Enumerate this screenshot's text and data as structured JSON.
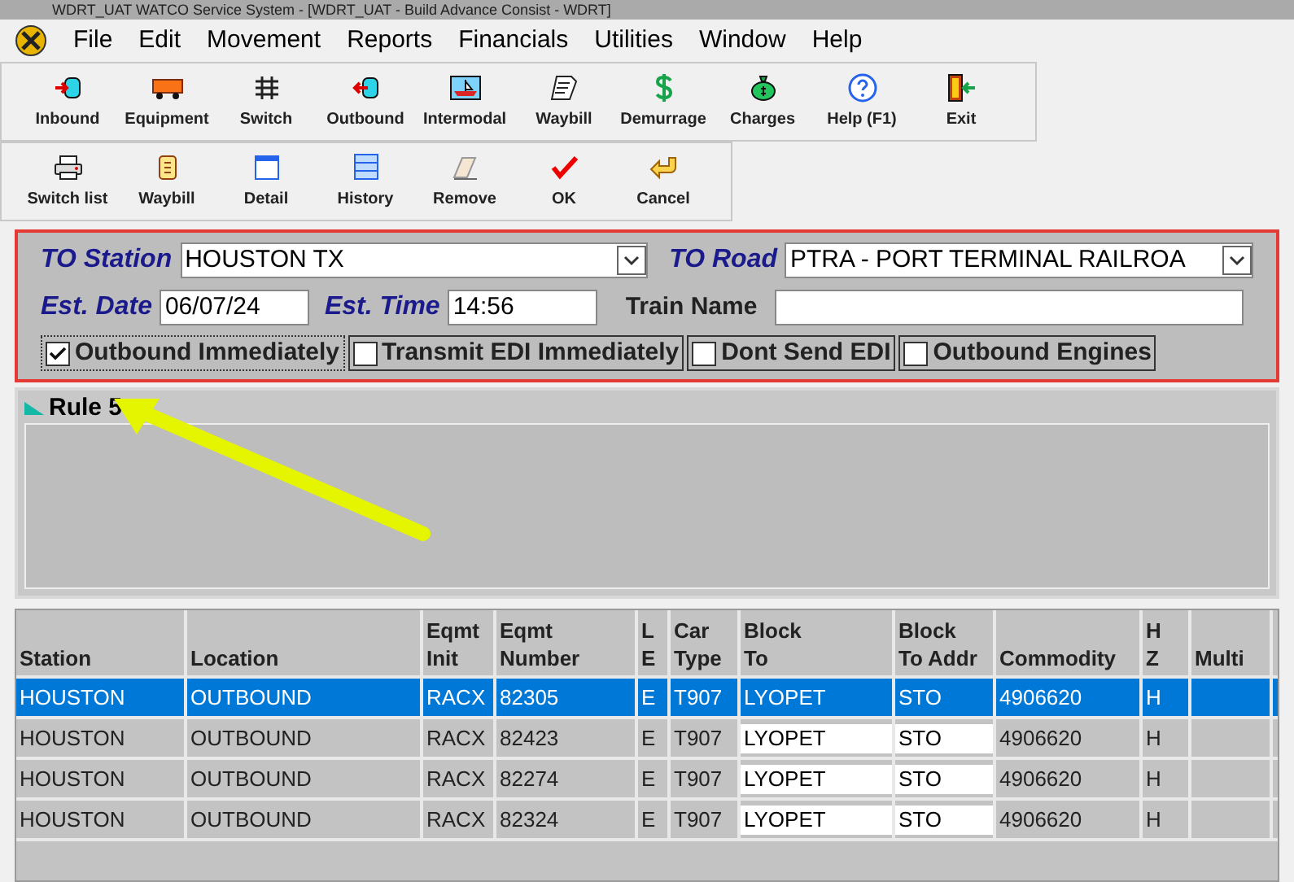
{
  "window": {
    "title": "WDRT_UAT WATCO Service System - [WDRT_UAT - Build Advance Consist - WDRT]"
  },
  "menu": [
    "File",
    "Edit",
    "Movement",
    "Reports",
    "Financials",
    "Utilities",
    "Window",
    "Help"
  ],
  "toolbar_rows": [
    [
      {
        "label": "Inbound"
      },
      {
        "label": "Equipment"
      },
      {
        "label": "Switch"
      },
      {
        "label": "Outbound"
      },
      {
        "label": "Intermodal"
      },
      {
        "label": "Waybill"
      },
      {
        "label": "Demurrage"
      },
      {
        "label": "Charges"
      },
      {
        "label": "Help (F1)"
      },
      {
        "label": "Exit"
      }
    ],
    [
      {
        "label": "Switch list"
      },
      {
        "label": "Waybill"
      },
      {
        "label": "Detail"
      },
      {
        "label": "History"
      },
      {
        "label": "Remove"
      },
      {
        "label": "OK"
      },
      {
        "label": "Cancel"
      }
    ]
  ],
  "form": {
    "to_station": {
      "label": "TO Station",
      "value": "HOUSTON TX"
    },
    "to_road": {
      "label": "TO Road",
      "value": "PTRA - PORT TERMINAL RAILROA"
    },
    "est_date": {
      "label": "Est. Date",
      "value": "06/07/24"
    },
    "est_time": {
      "label": "Est. Time",
      "value": "14:56"
    },
    "train_name": {
      "label": "Train Name"
    },
    "checkboxes": [
      {
        "label": "Outbound Immediately",
        "checked": true
      },
      {
        "label": "Transmit EDI Immediately",
        "checked": false
      },
      {
        "label": "Dont Send EDI",
        "checked": false
      },
      {
        "label": "Outbound Engines",
        "checked": false
      }
    ]
  },
  "rule_section": {
    "label": "Rule 5"
  },
  "table": {
    "columns": [
      {
        "label": "Station",
        "kind": "text"
      },
      {
        "label": "Location",
        "kind": "text"
      },
      {
        "label": "Eqmt\nInit",
        "kind": "text"
      },
      {
        "label": "Eqmt\nNumber",
        "kind": "text"
      },
      {
        "label": "L\nE",
        "kind": "text"
      },
      {
        "label": "Car\nType",
        "kind": "text"
      },
      {
        "label": "Block\nTo",
        "kind": "field"
      },
      {
        "label": "Block\nTo Addr",
        "kind": "field"
      },
      {
        "label": "Commodity",
        "kind": "text"
      },
      {
        "label": "H\nZ",
        "kind": "text"
      },
      {
        "label": "Multi",
        "kind": "text"
      }
    ],
    "rows": [
      {
        "selected": true,
        "cells": [
          "HOUSTON",
          "OUTBOUND",
          "RACX",
          "82305",
          "E",
          "T907",
          "LYOPET",
          "STO",
          "4906620",
          "H",
          ""
        ]
      },
      {
        "selected": false,
        "cells": [
          "HOUSTON",
          "OUTBOUND",
          "RACX",
          "82423",
          "E",
          "T907",
          "LYOPET",
          "STO",
          "4906620",
          "H",
          ""
        ]
      },
      {
        "selected": false,
        "cells": [
          "HOUSTON",
          "OUTBOUND",
          "RACX",
          "82274",
          "E",
          "T907",
          "LYOPET",
          "STO",
          "4906620",
          "H",
          ""
        ]
      },
      {
        "selected": false,
        "cells": [
          "HOUSTON",
          "OUTBOUND",
          "RACX",
          "82324",
          "E",
          "T907",
          "LYOPET",
          "STO",
          "4906620",
          "H",
          ""
        ]
      }
    ]
  }
}
